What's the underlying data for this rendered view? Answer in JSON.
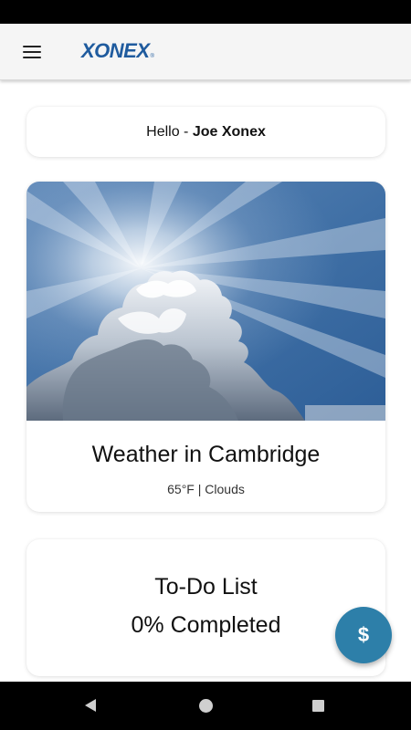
{
  "app_bar": {
    "menu_icon": "hamburger-menu-icon",
    "brand": "XONEX",
    "brand_mark": "®",
    "brand_color": "#1f5b9e",
    "background": "#f5f5f5"
  },
  "greeting": {
    "prefix": "Hello - ",
    "name": "Joe Xonex"
  },
  "weather": {
    "image_subject": "sky with sunlit cumulus cloud",
    "title": "Weather in Cambridge",
    "details": "65°F | Clouds"
  },
  "todo": {
    "title": "To-Do List",
    "progress": "0% Completed",
    "progress_value": 0
  },
  "fab": {
    "label": "$",
    "color": "#2d7fa9"
  },
  "nav": {
    "back_icon": "back-triangle-icon",
    "home_icon": "home-circle-icon",
    "recents_icon": "recents-square-icon"
  }
}
